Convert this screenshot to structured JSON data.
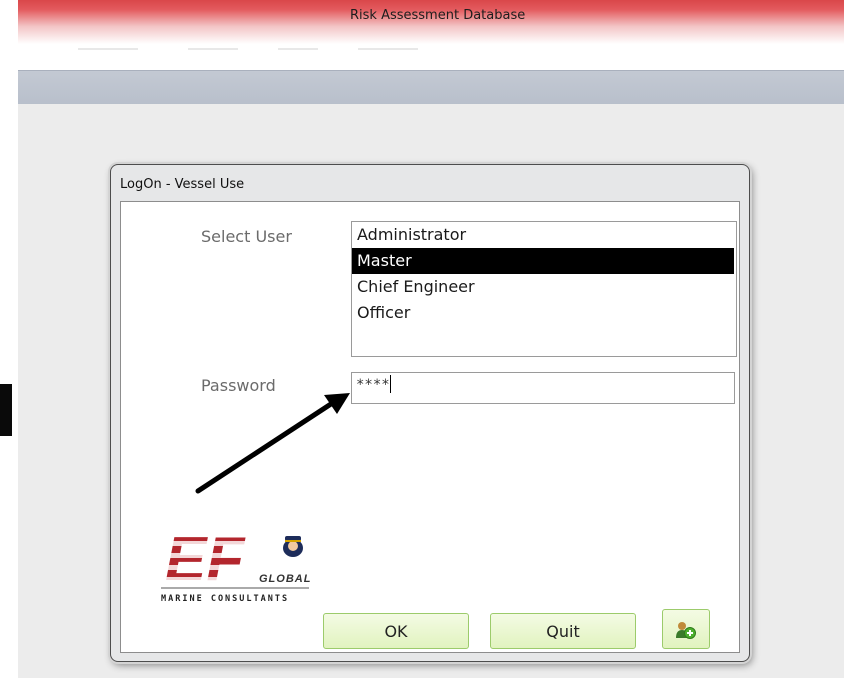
{
  "window": {
    "title": "Risk Assessment Database"
  },
  "dialog": {
    "title": "LogOn - Vessel Use",
    "select_user_label": "Select User",
    "password_label": "Password",
    "users": [
      "Administrator",
      "Master",
      "Chief Engineer",
      "Officer"
    ],
    "selected_user": "Master",
    "password_value": "****",
    "ok_label": "OK",
    "quit_label": "Quit",
    "add_user_icon": "add-user-icon"
  },
  "logo": {
    "mark": "EF",
    "global_text": "GLOBAL",
    "tagline": "MARINE CONSULTANTS"
  },
  "colors": {
    "titlebar_accent": "#d9474a",
    "button_fill": "#e1f3bf",
    "button_border": "#9ccb6b",
    "selection": "#000000",
    "logo_red": "#b3262d"
  }
}
